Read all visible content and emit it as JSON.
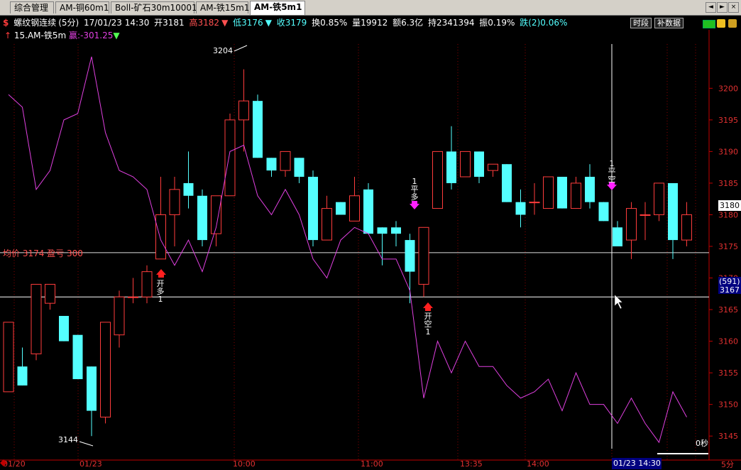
{
  "tabs": [
    "综合管理",
    "AM-铜60m1",
    "Boll-矿石30m10001",
    "AM-铁15m1",
    "AM-铁5m1"
  ],
  "window_buttons": [
    "◄",
    "►",
    "×"
  ],
  "infobar": {
    "indicator": "螺纹钢连续",
    "period": "(5分)",
    "datetime": "17/01/23 14:30",
    "open": "开3181",
    "high": "高3182",
    "low": "低3176",
    "close": "收3179",
    "turnover_rate": "换0.85%",
    "volume": "量19912",
    "amount": "额6.3亿",
    "open_interest": "持2341394",
    "amplitude": "振0.19%",
    "change": "跌(2)0.06%",
    "btn_period": "时段",
    "btn_fill": "补数据"
  },
  "legend2": {
    "strategy": "15.AM-铁5m",
    "profit": "赢:-301.25"
  },
  "avg_label": "均价 3174 盈亏 300",
  "annotations": {
    "high_label": "3204",
    "low_label": "3144"
  },
  "price_tags": {
    "current": "3180",
    "cursor_count": "(591)",
    "cursor_price": "3167"
  },
  "time_tag": "01/23 14:30",
  "countdown": "0秒",
  "period_label": "5分",
  "colors": {
    "up": "#ff3c3c",
    "down": "#54ffff",
    "line": "#e040e0",
    "axis": "#c00000",
    "grid": "#8b0000",
    "tab_active": "#ffffff"
  },
  "signals": [
    {
      "label": "开多",
      "count": "1",
      "type": "buy"
    },
    {
      "label": "平多",
      "count": "1",
      "type": "sell"
    },
    {
      "label": "开空",
      "count": "1",
      "type": "buy"
    },
    {
      "label": "平空",
      "count": "1",
      "type": "sell"
    }
  ],
  "chart_data": {
    "type": "candlestick",
    "y_ticks": [
      3145,
      3150,
      3155,
      3160,
      3165,
      3170,
      3175,
      3180,
      3185,
      3190,
      3195,
      3200
    ],
    "x_labels": [
      "01/20",
      "01/23",
      "10:00",
      "11:00",
      "13:35",
      "14:00",
      "5分"
    ],
    "ylim": [
      3143,
      3207
    ],
    "candles": [
      {
        "o": 3152,
        "h": 3163,
        "l": 3152,
        "c": 3163
      },
      {
        "o": 3156,
        "h": 3159,
        "l": 3153,
        "c": 3153
      },
      {
        "o": 3158,
        "h": 3169,
        "l": 3157,
        "c": 3169
      },
      {
        "o": 3166,
        "h": 3169,
        "l": 3165,
        "c": 3169
      },
      {
        "o": 3164,
        "h": 3164,
        "l": 3160,
        "c": 3160
      },
      {
        "o": 3161,
        "h": 3161,
        "l": 3154,
        "c": 3154
      },
      {
        "o": 3156,
        "h": 3156,
        "l": 3145,
        "c": 3149
      },
      {
        "o": 3148,
        "h": 3163,
        "l": 3147,
        "c": 3163
      },
      {
        "o": 3161,
        "h": 3168,
        "l": 3159,
        "c": 3167
      },
      {
        "o": 3167,
        "h": 3170,
        "l": 3166,
        "c": 3167
      },
      {
        "o": 3167,
        "h": 3172,
        "l": 3166,
        "c": 3171
      },
      {
        "o": 3173,
        "h": 3186,
        "l": 3173,
        "c": 3180
      },
      {
        "o": 3180,
        "h": 3186,
        "l": 3175,
        "c": 3184
      },
      {
        "o": 3185,
        "h": 3190,
        "l": 3181,
        "c": 3183
      },
      {
        "o": 3183,
        "h": 3184,
        "l": 3175,
        "c": 3176
      },
      {
        "o": 3177,
        "h": 3183,
        "l": 3175,
        "c": 3183
      },
      {
        "o": 3183,
        "h": 3196,
        "l": 3183,
        "c": 3195
      },
      {
        "o": 3195,
        "h": 3203,
        "l": 3190,
        "c": 3198
      },
      {
        "o": 3198,
        "h": 3199,
        "l": 3189,
        "c": 3189
      },
      {
        "o": 3189,
        "h": 3189,
        "l": 3186,
        "c": 3187
      },
      {
        "o": 3187,
        "h": 3190,
        "l": 3186,
        "c": 3190
      },
      {
        "o": 3189,
        "h": 3189,
        "l": 3185,
        "c": 3186
      },
      {
        "o": 3186,
        "h": 3187,
        "l": 3175,
        "c": 3176
      },
      {
        "o": 3176,
        "h": 3183,
        "l": 3176,
        "c": 3181
      },
      {
        "o": 3182,
        "h": 3182,
        "l": 3180,
        "c": 3180
      },
      {
        "o": 3179,
        "h": 3186,
        "l": 3179,
        "c": 3183
      },
      {
        "o": 3184,
        "h": 3185,
        "l": 3177,
        "c": 3177
      },
      {
        "o": 3178,
        "h": 3178,
        "l": 3172,
        "c": 3177
      },
      {
        "o": 3178,
        "h": 3179,
        "l": 3175,
        "c": 3177
      },
      {
        "o": 3176,
        "h": 3177,
        "l": 3166,
        "c": 3171
      },
      {
        "o": 3169,
        "h": 3177,
        "l": 3167,
        "c": 3178
      },
      {
        "o": 3181,
        "h": 3190,
        "l": 3181,
        "c": 3190
      },
      {
        "o": 3190,
        "h": 3194,
        "l": 3184,
        "c": 3185
      },
      {
        "o": 3186,
        "h": 3190,
        "l": 3186,
        "c": 3190
      },
      {
        "o": 3190,
        "h": 3190,
        "l": 3185,
        "c": 3186
      },
      {
        "o": 3187,
        "h": 3188,
        "l": 3186,
        "c": 3188
      },
      {
        "o": 3188,
        "h": 3188,
        "l": 3182,
        "c": 3182
      },
      {
        "o": 3182,
        "h": 3184,
        "l": 3178,
        "c": 3180
      },
      {
        "o": 3182,
        "h": 3185,
        "l": 3180,
        "c": 3182
      },
      {
        "o": 3181,
        "h": 3186,
        "l": 3181,
        "c": 3186
      },
      {
        "o": 3186,
        "h": 3186,
        "l": 3181,
        "c": 3181
      },
      {
        "o": 3181,
        "h": 3186,
        "l": 3181,
        "c": 3185
      },
      {
        "o": 3186,
        "h": 3188,
        "l": 3181,
        "c": 3182
      },
      {
        "o": 3182,
        "h": 3182,
        "l": 3179,
        "c": 3179
      },
      {
        "o": 3178,
        "h": 3179,
        "l": 3176,
        "c": 3175
      },
      {
        "o": 3176,
        "h": 3182,
        "l": 3173,
        "c": 3181
      },
      {
        "o": 3180,
        "h": 3182,
        "l": 3176,
        "c": 3180
      },
      {
        "o": 3180,
        "h": 3185,
        "l": 3179,
        "c": 3185
      },
      {
        "o": 3185,
        "h": 3185,
        "l": 3173,
        "c": 3176
      },
      {
        "o": 3176,
        "h": 3182,
        "l": 3175,
        "c": 3180
      }
    ],
    "line": [
      3199,
      3197,
      3184,
      3187,
      3195,
      3196,
      3205,
      3193,
      3187,
      3186,
      3184,
      3176,
      3172,
      3176,
      3171,
      3178,
      3190,
      3191,
      3183,
      3180,
      3184,
      3180,
      3173,
      3170,
      3176,
      3178,
      3177,
      3173,
      3173,
      3168,
      3151,
      3160,
      3155,
      3160,
      3156,
      3156,
      3153,
      3151,
      3152,
      3154,
      3149,
      3155,
      3150,
      3150,
      3147,
      3151,
      3147,
      3144,
      3152,
      3148
    ],
    "avg_price": 3174,
    "cursor_price": 3167,
    "current_price": 3180
  }
}
